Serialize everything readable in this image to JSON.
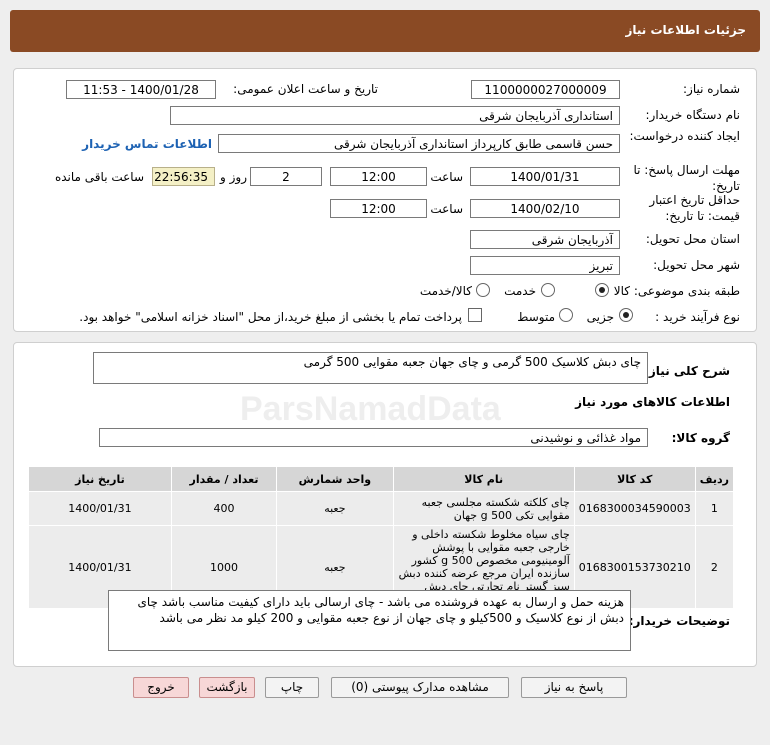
{
  "header": {
    "title": "جزئیات اطلاعات نیاز"
  },
  "form": {
    "need_number_label": "شماره نیاز:",
    "need_number": "1100000027000009",
    "announce_label": "تاریخ و ساعت اعلان عمومی:",
    "announce_value": "1400/01/28 - 11:53",
    "buyer_org_label": "نام دستگاه خریدار:",
    "buyer_org": "استانداری آذربایجان شرقی",
    "creator_label": "ایجاد کننده درخواست:",
    "creator": "حسن قاسمی طابق کارپرداز استانداری آذربایجان شرقی",
    "contact_link": "اطلاعات تماس خریدار",
    "deadline_label": "مهلت ارسال پاسخ: تا تاریخ:",
    "deadline_date": "1400/01/31",
    "time_label": "ساعت",
    "deadline_time": "12:00",
    "days_value": "2",
    "days_label": "روز و",
    "remaining_time": "22:56:35",
    "remaining_label": "ساعت باقی مانده",
    "validity_label": "حداقل تاریخ اعتبار قیمت: تا تاریخ:",
    "validity_date": "1400/02/10",
    "validity_time": "12:00",
    "province_label": "استان محل تحویل:",
    "province": "آذربایجان شرقی",
    "city_label": "شهر محل تحویل:",
    "city": "تبریز",
    "category_label": "طبقه بندی موضوعی:",
    "category_options": [
      "کالا",
      "خدمت",
      "کالا/خدمت"
    ],
    "process_label": "نوع فرآیند خرید :",
    "process_options": [
      "جزیی",
      "متوسط"
    ],
    "payment_note": "پرداخت تمام یا بخشی از مبلغ خرید،از محل \"اسناد خزانه اسلامی\" خواهد بود."
  },
  "details": {
    "summary_label": "شرح کلی نیاز:",
    "summary": "چای دبش کلاسیک 500 گرمی و چای جهان جعبه مقوایی 500 گرمی",
    "goods_info_title": "اطلاعات کالاهای مورد نیاز",
    "goods_group_label": "گروه کالا:",
    "goods_group": "مواد غذائی و نوشیدنی",
    "table_headers": [
      "ردیف",
      "کد کالا",
      "نام کالا",
      "واحد شمارش",
      "تعداد / مقدار",
      "تاریخ نیاز"
    ],
    "rows": [
      {
        "idx": "1",
        "code": "0168300034590003",
        "name": "چای کلکته شکسته مجلسی جعبه مقوایی تکی 500 g جهان",
        "unit": "جعبه",
        "qty": "400",
        "date": "1400/01/31"
      },
      {
        "idx": "2",
        "code": "0168300153730210",
        "name": "چای سیاه مخلوط شکسته داخلی و خارجی جعبه مقوایی با پوشش آلومینیومی مخصوص 500 g کشور سازنده ایران مرجع عرضه کننده دبش سبز گستر نام تجارتی چای دبش مرجع سازنده دبش سبز گستر",
        "unit": "جعبه",
        "qty": "1000",
        "date": "1400/01/31"
      }
    ],
    "buyer_notes_label": "توضیحات خریدار:",
    "buyer_notes": "هزینه حمل و ارسال به عهده فروشنده می باشد - چای ارسالی باید دارای کیفیت مناسب باشد چای دبش از نوع کلاسیک و 500کیلو و چای جهان از نوع جعبه مقوایی و 200 کیلو مد نظر می باشد"
  },
  "buttons": {
    "reply": "پاسخ به نیاز",
    "attachments": "مشاهده مدارک پیوستی (0)",
    "print": "چاپ",
    "back": "بازگشت",
    "exit": "خروج"
  },
  "watermark": {
    "text": "ParsNamadData"
  }
}
